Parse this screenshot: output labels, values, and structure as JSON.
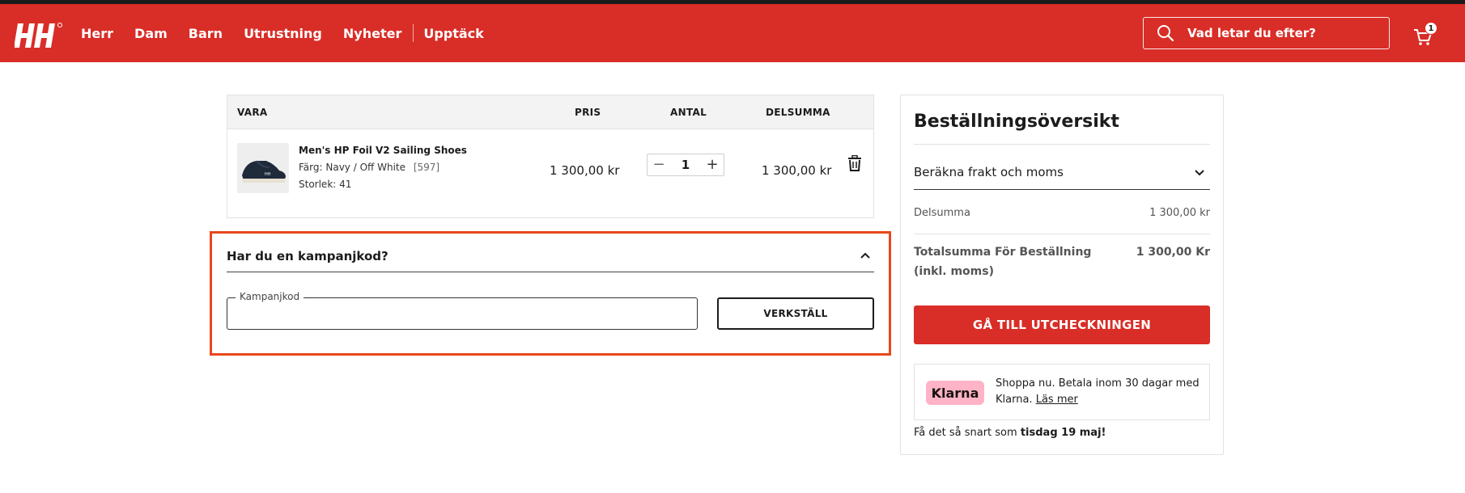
{
  "header": {
    "nav": [
      {
        "label": "Herr"
      },
      {
        "label": "Dam"
      },
      {
        "label": "Barn"
      },
      {
        "label": "Utrustning"
      },
      {
        "label": "Nyheter"
      },
      {
        "label": "Upptäck"
      }
    ],
    "search_placeholder": "Vad letar du efter?",
    "cart_count": "1",
    "brand_color": "#d92d27"
  },
  "cart": {
    "columns": {
      "item": "VARA",
      "price": "PRIS",
      "qty": "ANTAL",
      "subtotal": "DELSUMMA"
    },
    "items": [
      {
        "name": "Men's HP Foil V2 Sailing Shoes",
        "color_label": "Färg:",
        "color_value": "Navy / Off White",
        "color_code": "[597]",
        "size_label": "Storlek:",
        "size_value": "41",
        "price": "1 300,00 kr",
        "quantity": "1",
        "subtotal": "1 300,00 kr"
      }
    ]
  },
  "promo": {
    "title": "Har du en kampanjkod?",
    "field_label": "Kampanjkod",
    "apply_label": "VERKSTÄLL"
  },
  "summary": {
    "title": "Beställningsöversikt",
    "shipping_label": "Beräkna frakt och moms",
    "subtotal_label": "Delsumma",
    "subtotal_value": "1 300,00 kr",
    "total_label": "Totalsumma För Beställning (inkl. moms)",
    "total_value": "1 300,00 Kr",
    "checkout_label": "GÅ TILL UTCHECKNINGEN",
    "klarna_brand": "Klarna",
    "klarna_text": "Shoppa nu. Betala inom 30 dagar med Klarna.",
    "klarna_link": "Läs mer",
    "delivery_prefix": "Få det så snart som",
    "delivery_date": "tisdag 19 maj!"
  }
}
